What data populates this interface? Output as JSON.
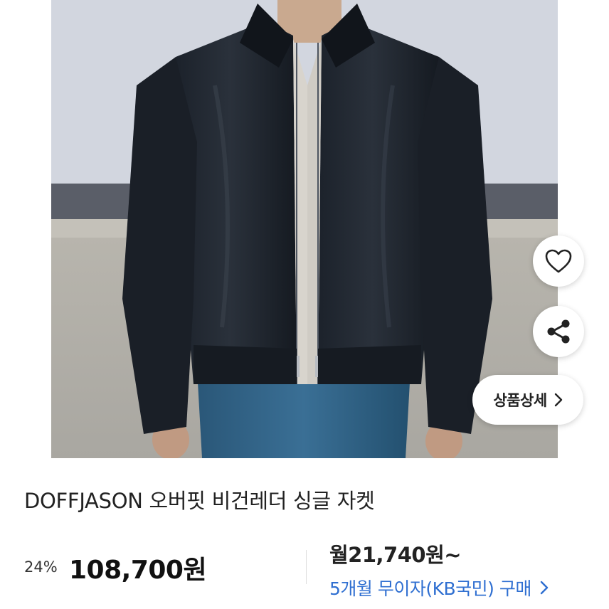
{
  "product": {
    "image_alt": "black leather jacket photo",
    "title": "DOFFJASON 오버핏 비건레더 싱글 자켓",
    "discount": "24%",
    "price": "108,700원",
    "monthly_price": "월21,740원~",
    "installment_link": "5개월 무이자(KB국민) 구매"
  },
  "actions": {
    "like_icon": "heart-icon",
    "share_icon": "share-icon",
    "detail_label": "상품상세",
    "detail_icon": "chevron-right-icon"
  },
  "colors": {
    "link_blue": "#2f6fd1",
    "text_dark": "#222222"
  }
}
